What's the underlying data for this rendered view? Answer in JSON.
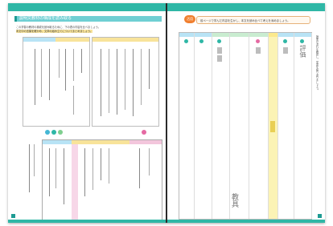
{
  "left_page": {
    "heading": "説明文教材の構成を読み取る",
    "instructions": [
      "この学習の教材の構成を読み取るために、下の表の内容を比べましょう。",
      "本文中の言葉を確かめ、文章の組み立てについてまとめましょう。"
    ]
  },
  "right_page": {
    "badge": "活用",
    "instruction": "前ページで学んだ内容を生かし、本文を読み比べて考えを深めましょう。",
    "vertical_words": [
      "評価",
      "教具"
    ],
    "side_note": "授業の流れを確認し、学習を振り返りましょう。"
  },
  "colors": {
    "teal": "#2fb7a6",
    "teal_dark": "#1e9b93",
    "orange": "#f07f2f",
    "yellow": "#fbf3b5",
    "pink": "#f7d7e8",
    "blue": "#cfe7fa"
  }
}
